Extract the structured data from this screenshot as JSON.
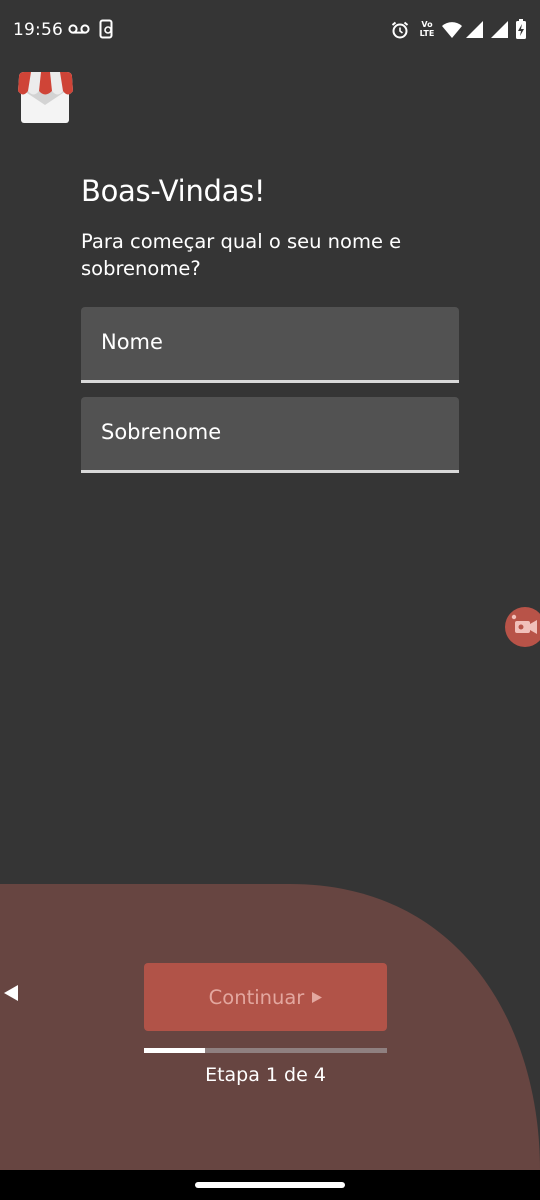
{
  "status_bar": {
    "time": "19:56",
    "left_icons": [
      "voicemail-icon",
      "phone-screen-icon"
    ],
    "right_icons": [
      "alarm-icon",
      "volte-icon",
      "wifi-icon",
      "signal-icon",
      "signal-icon",
      "battery-charging-icon"
    ],
    "volte_line1": "Vo",
    "volte_line2": "LTE"
  },
  "app": {
    "logo_icon": "storefront-awning-icon"
  },
  "welcome": {
    "title": "Boas-Vindas!",
    "subtitle": "Para começar qual o seu nome e sobrenome?"
  },
  "form": {
    "first_name": {
      "placeholder": "Nome",
      "value": ""
    },
    "last_name": {
      "placeholder": "Sobrenome",
      "value": ""
    }
  },
  "floating": {
    "record_icon": "video-record-icon"
  },
  "footer": {
    "back_icon": "triangle-left-icon",
    "continue_label": "Continuar",
    "continue_icon": "triangle-right-icon",
    "step_label": "Etapa 1 de 4",
    "progress_fraction": 0.25
  },
  "colors": {
    "background": "#353535",
    "field": "#525252",
    "panel": "#674541",
    "accent": "#b15348",
    "button_text": "#e3a79f"
  }
}
